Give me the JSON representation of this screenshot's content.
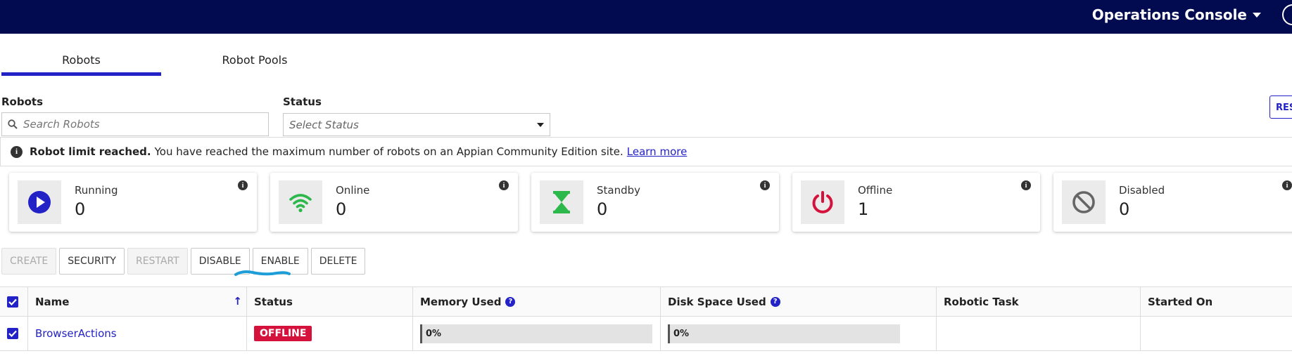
{
  "header": {
    "title": "Operations Console"
  },
  "tabs": [
    {
      "label": "Robots",
      "active": true
    },
    {
      "label": "Robot Pools",
      "active": false
    }
  ],
  "filters": {
    "robots_label": "Robots",
    "search_placeholder": "Search Robots",
    "status_label": "Status",
    "status_placeholder": "Select Status",
    "reset_label": "RES"
  },
  "banner": {
    "bold": "Robot limit reached.",
    "text": "You have reached the maximum number of robots on an Appian Community Edition site.",
    "link": "Learn more"
  },
  "stats": [
    {
      "label": "Running",
      "count": "0",
      "icon": "play-icon",
      "color": "#2322c7"
    },
    {
      "label": "Online",
      "count": "0",
      "icon": "wifi-icon",
      "color": "#2db84b"
    },
    {
      "label": "Standby",
      "count": "0",
      "icon": "hourglass-icon",
      "color": "#2db84b"
    },
    {
      "label": "Offline",
      "count": "1",
      "icon": "power-icon",
      "color": "#d5123c"
    },
    {
      "label": "Disabled",
      "count": "0",
      "icon": "ban-icon",
      "color": "#666666"
    }
  ],
  "actions": {
    "create": "CREATE",
    "security": "SECURITY",
    "restart": "RESTART",
    "disable": "DISABLE",
    "enable": "ENABLE",
    "delete": "DELETE"
  },
  "table": {
    "headers": {
      "name": "Name",
      "status": "Status",
      "memory": "Memory Used",
      "disk": "Disk Space Used",
      "task": "Robotic Task",
      "started": "Started On"
    },
    "rows": [
      {
        "name": "BrowserActions",
        "status": "OFFLINE",
        "memory": "0%",
        "disk": "0%",
        "task": "",
        "started": ""
      }
    ]
  },
  "colors": {
    "navy": "#020b4f",
    "accent": "#2322c7",
    "danger": "#d5123c"
  }
}
